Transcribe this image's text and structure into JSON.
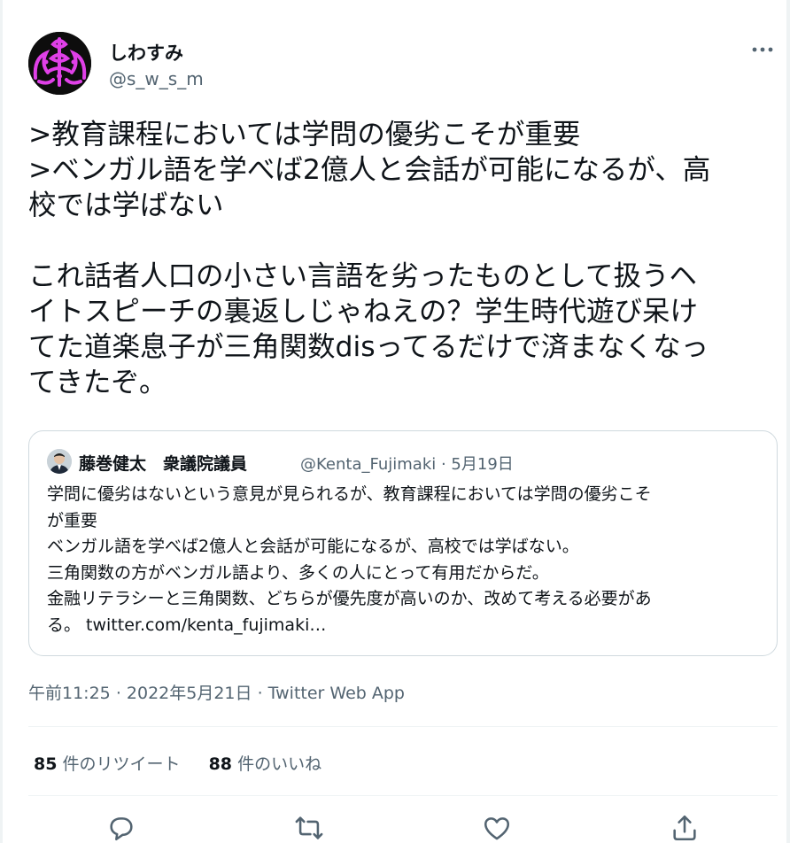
{
  "author": {
    "display_name": "しわすみ",
    "handle": "@s_w_s_m"
  },
  "tweet": {
    "text": ">教育課程においては学問の優劣こそが重要\n>ベンガル語を学べば2億人と会話が可能になるが、高\n校では学ばない\n\nこれ話者人口の小さい言語を劣ったものとして扱うヘ\nイトスピーチの裏返しじゃねえの？学生時代遊び呆け\nてた道楽息子が三角関数disってるだけで済まなくなっ\nてきたぞ。"
  },
  "quoted": {
    "name": "藤巻健太　衆議院議員",
    "handle_date": "@Kenta_Fujimaki · 5月19日",
    "text": "学問に優劣はないという意見が見られるが、教育課程においては学問の優劣こそ\nが重要\nベンガル語を学べば2億人と会話が可能になるが、高校では学ばない。\n三角関数の方がベンガル語より、多くの人にとって有用だからだ。\n金融リテラシーと三角関数、どちらが優先度が高いのか、改めて考える必要があ\nる。 twitter.com/kenta_fujimaki…"
  },
  "meta": {
    "time": "午前11:25",
    "date": "2022年5月21日",
    "client": "Twitter Web App"
  },
  "stats": {
    "retweets_count": "85",
    "retweets_label": "件のリツイート",
    "likes_count": "88",
    "likes_label": "件のいいね"
  },
  "icons": {
    "more": "more-horizontal-icon",
    "reply": "reply-icon",
    "retweet": "retweet-icon",
    "like": "heart-icon",
    "share": "share-icon"
  },
  "colors": {
    "text": "#0f1419",
    "secondary": "#536471",
    "border": "#cfd9de",
    "avatar_accent": "#e040e8"
  }
}
